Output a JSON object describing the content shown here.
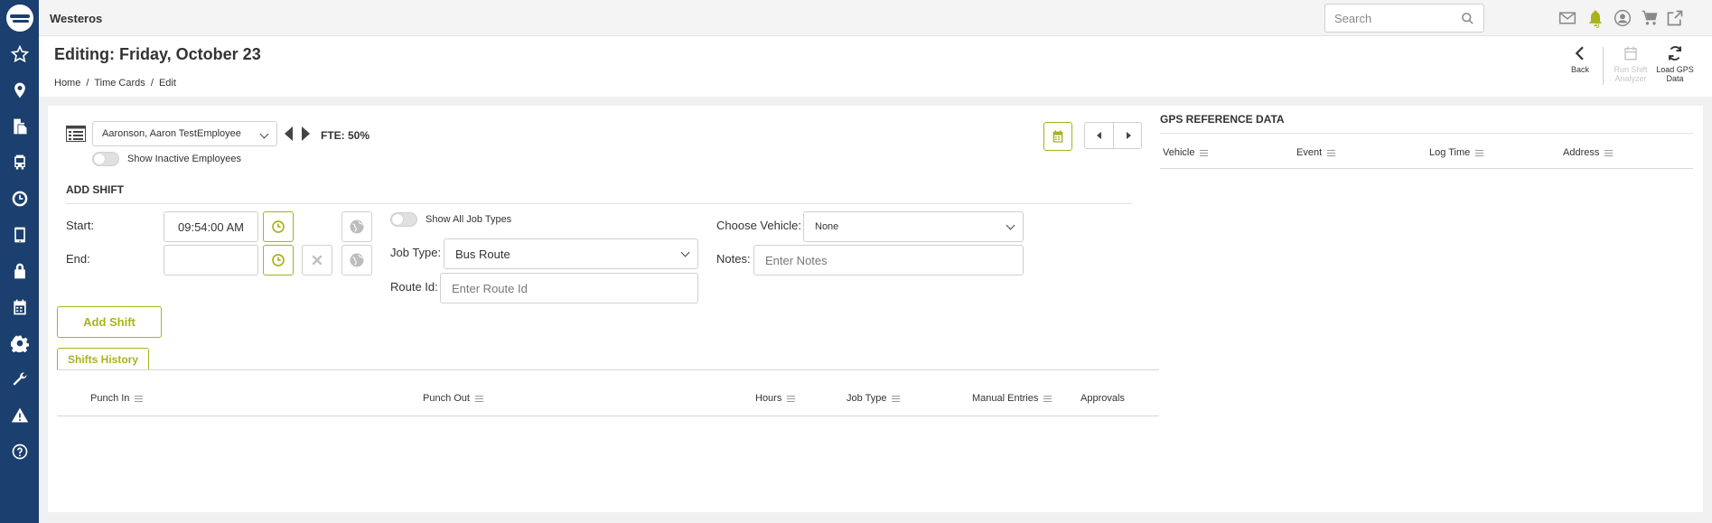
{
  "app": {
    "title": "Westeros"
  },
  "search": {
    "placeholder": "Search"
  },
  "notifications": {
    "count": "9"
  },
  "colors": {
    "sidebar": "#1b3f6e",
    "accent": "#a9b31c"
  },
  "sidebar": {
    "items": [
      {
        "icon": "star-icon"
      },
      {
        "icon": "map-pin-icon"
      },
      {
        "icon": "documents-icon"
      },
      {
        "icon": "bus-icon"
      },
      {
        "icon": "clock-icon"
      },
      {
        "icon": "tablet-icon"
      },
      {
        "icon": "lock-icon"
      },
      {
        "icon": "calendar-icon"
      },
      {
        "icon": "gear-icon"
      },
      {
        "icon": "wrench-icon"
      },
      {
        "icon": "warning-icon"
      },
      {
        "icon": "help-icon"
      }
    ]
  },
  "header": {
    "title": "Editing: Friday, October 23",
    "breadcrumb": [
      "Home",
      "/",
      "Time Cards",
      "/",
      "Edit"
    ],
    "back_label": "Back",
    "run_shift_analyzer_label": "Run Shift Analyzer",
    "load_gps_label": "Load GPS Data"
  },
  "employee": {
    "selected": "Aaronson, Aaron TestEmployee",
    "fte": "FTE: 50%",
    "show_inactive_label": "Show Inactive Employees"
  },
  "add_shift": {
    "title": "ADD SHIFT",
    "start_label": "Start:",
    "start_value": "09:54:00 AM",
    "end_label": "End:",
    "end_value": "",
    "show_all_job_types_label": "Show All Job Types",
    "job_type_label": "Job Type:",
    "job_type_value": "Bus Route",
    "route_id_label": "Route Id:",
    "route_id_placeholder": "Enter Route Id",
    "vehicle_label": "Choose Vehicle:",
    "vehicle_value": "None",
    "notes_label": "Notes:",
    "notes_placeholder": "Enter Notes",
    "add_button": "Add Shift"
  },
  "history": {
    "tab": "Shifts History",
    "columns": [
      "Punch In",
      "Punch Out",
      "Hours",
      "Job Type",
      "Manual Entries",
      "Approvals"
    ]
  },
  "gps": {
    "title": "GPS REFERENCE DATA",
    "columns": [
      "Vehicle",
      "Event",
      "Log Time",
      "Address"
    ]
  }
}
